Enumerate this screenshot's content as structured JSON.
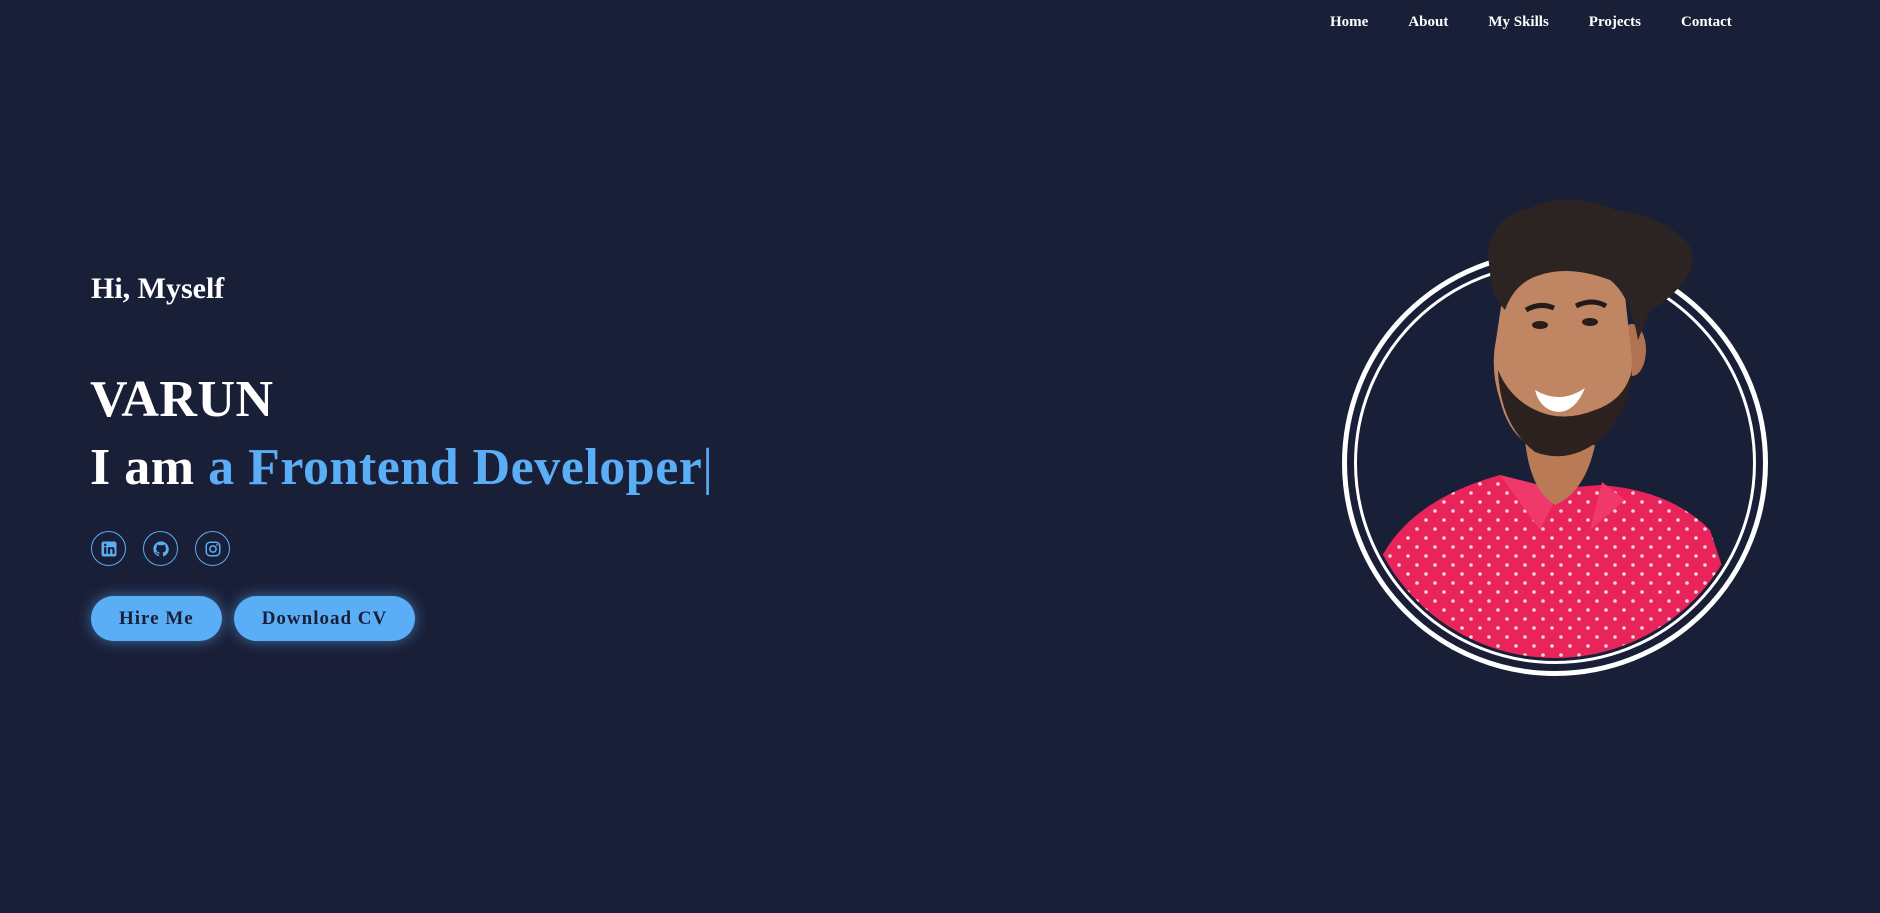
{
  "nav": {
    "items": [
      {
        "label": "Home"
      },
      {
        "label": "About"
      },
      {
        "label": "My Skills"
      },
      {
        "label": "Projects"
      },
      {
        "label": "Contact"
      }
    ]
  },
  "hero": {
    "greeting": "Hi, Myself",
    "name": "VARUN",
    "role_prefix": "I am ",
    "role_typed": "a Frontend Developer",
    "cursor": "|"
  },
  "socials": [
    {
      "icon": "linkedin-icon"
    },
    {
      "icon": "github-icon"
    },
    {
      "icon": "instagram-icon"
    }
  ],
  "buttons": {
    "hire_label": "Hire Me",
    "cv_label": "Download CV"
  },
  "colors": {
    "background": "#1a1f38",
    "accent": "#5aaef5",
    "text": "#ffffff",
    "shirt": "#e8245a"
  }
}
